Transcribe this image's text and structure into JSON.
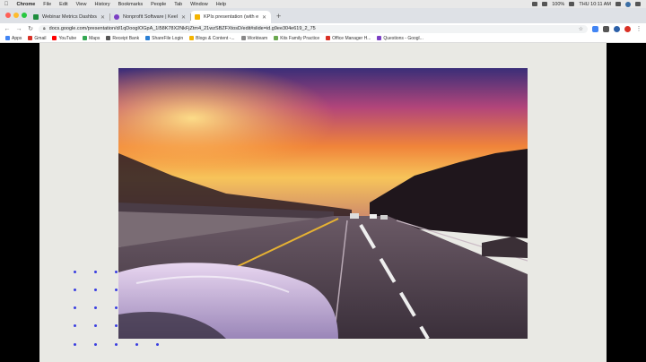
{
  "menubar": {
    "app": "Chrome",
    "items": [
      "File",
      "Edit",
      "View",
      "History",
      "Bookmarks",
      "People",
      "Tab",
      "Window",
      "Help"
    ],
    "battery": "100%",
    "clock": "THU 10:11 AM"
  },
  "tabs": [
    {
      "title": "Webinar Metrics Dashboard a",
      "color": "#1e8e3e",
      "active": false
    },
    {
      "title": "Nonprofit Software | Keela",
      "color": "#7b3fc4",
      "active": false
    },
    {
      "title": "KPIs presentation (with edits)",
      "color": "#f4b400",
      "active": true
    }
  ],
  "address_bar": {
    "url": "docs.google.com/presentation/d/1qDoogIOGpA_1l58K78X2NkFjZtm4_21wzSBZFXtosD/edit#slide=id.g9ee304e619_2_75"
  },
  "bookmarks": [
    {
      "label": "Apps",
      "color": "#4285f4"
    },
    {
      "label": "Gmail",
      "color": "#d93025"
    },
    {
      "label": "YouTube",
      "color": "#ff0000"
    },
    {
      "label": "Maps",
      "color": "#34a853"
    },
    {
      "label": "Receipt Bank",
      "color": "#555555"
    },
    {
      "label": "ShareFile Login",
      "color": "#2a7fd4"
    },
    {
      "label": "Blogs & Content -...",
      "color": "#f4b400"
    },
    {
      "label": "Workteam",
      "color": "#888888"
    },
    {
      "label": "Kits Family Practice",
      "color": "#6aa84f"
    },
    {
      "label": "Office Manager H...",
      "color": "#d93025"
    },
    {
      "label": "Questions - Googl...",
      "color": "#7b3fc4"
    }
  ],
  "slide": {
    "accent_color": "#3a3ee0",
    "background_color": "#e9e9e4"
  }
}
